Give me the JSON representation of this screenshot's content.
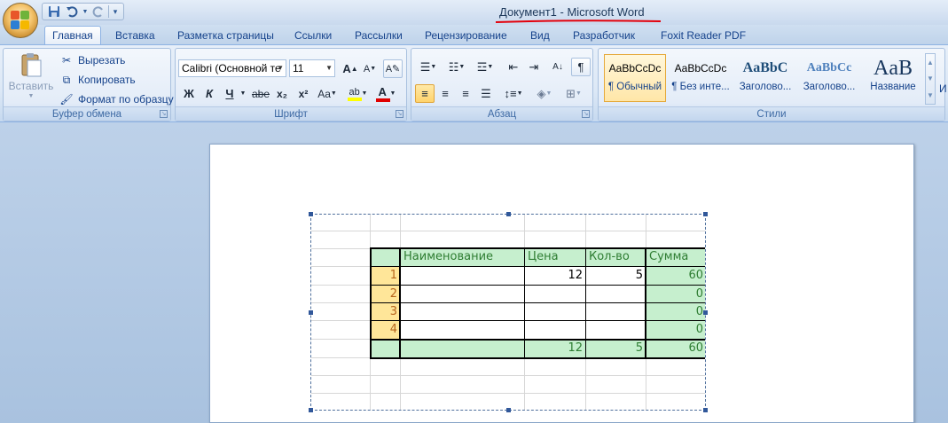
{
  "window": {
    "title": "Документ1 - Microsoft Word"
  },
  "quick_access": {
    "save": "save-icon",
    "undo": "undo-icon",
    "redo": "redo-icon"
  },
  "tabs": [
    {
      "label": "Главная",
      "active": true
    },
    {
      "label": "Вставка"
    },
    {
      "label": "Разметка страницы"
    },
    {
      "label": "Ссылки"
    },
    {
      "label": "Рассылки"
    },
    {
      "label": "Рецензирование"
    },
    {
      "label": "Вид"
    },
    {
      "label": "Разработчик"
    },
    {
      "label": "Foxit Reader PDF"
    }
  ],
  "clipboard": {
    "group_label": "Буфер обмена",
    "paste": "Вставить",
    "cut": "Вырезать",
    "copy": "Копировать",
    "format_painter": "Формат по образцу"
  },
  "font": {
    "group_label": "Шрифт",
    "font_name": "Calibri (Основной те",
    "font_size": "11",
    "bold": "Ж",
    "italic": "К",
    "underline": "Ч",
    "strike": "abe",
    "subscript": "x₂",
    "superscript": "x²",
    "change_case": "Aa",
    "grow": "A",
    "shrink": "A",
    "highlight_color": "#ffff00",
    "font_color": "#e00000"
  },
  "paragraph": {
    "group_label": "Абзац"
  },
  "styles": {
    "group_label": "Стили",
    "items": [
      {
        "sample": "AaBbCcDc",
        "name": "¶ Обычный",
        "selected": true
      },
      {
        "sample": "AaBbCcDc",
        "name": "¶ Без инте..."
      },
      {
        "sample": "AaBbC",
        "name": "Заголово..."
      },
      {
        "sample": "AaBbCc",
        "name": "Заголово..."
      },
      {
        "sample": "AaB",
        "name": "Название"
      }
    ],
    "more": "И"
  },
  "table": {
    "headers": [
      "Наименование",
      "Цена",
      "Кол-во",
      "Сумма"
    ],
    "rows": [
      {
        "n": "1",
        "name": "",
        "price": "12",
        "qty": "5",
        "sum": "60"
      },
      {
        "n": "2",
        "name": "",
        "price": "",
        "qty": "",
        "sum": "0"
      },
      {
        "n": "3",
        "name": "",
        "price": "",
        "qty": "",
        "sum": "0"
      },
      {
        "n": "4",
        "name": "",
        "price": "",
        "qty": "",
        "sum": "0"
      }
    ],
    "totals": {
      "price": "12",
      "qty": "5",
      "sum": "60"
    },
    "colors": {
      "green": "#c6efce",
      "orange": "#ffe699",
      "green_text": "#2e7d32",
      "orange_text": "#b7651c"
    }
  }
}
